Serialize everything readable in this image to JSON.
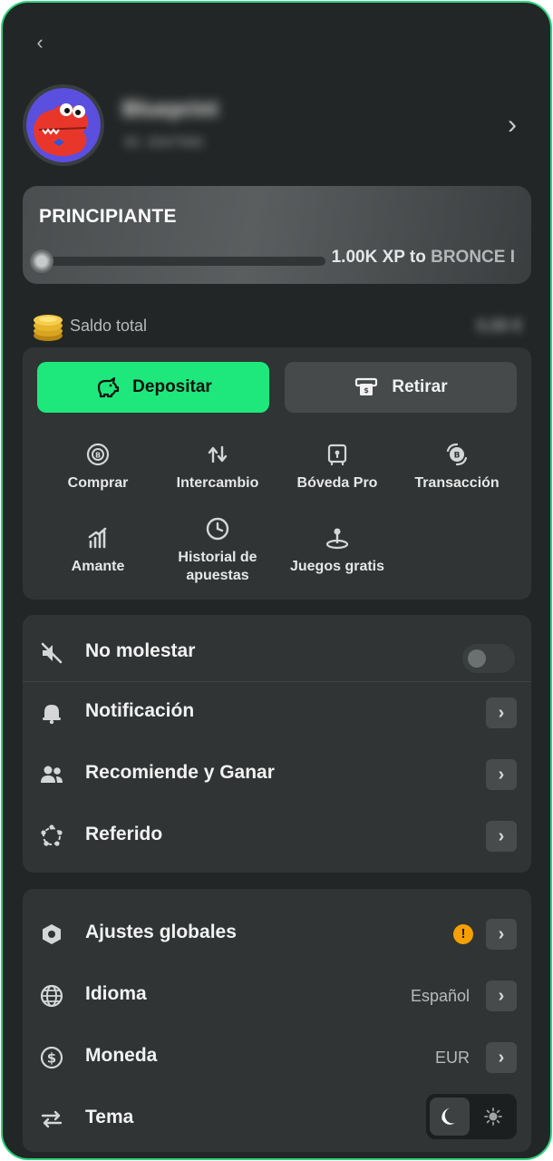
{
  "profile": {
    "username": "Blueprint",
    "user_id": "ID: 3347560"
  },
  "level": {
    "name": "PRINCIPIANTE",
    "xp_amount": "1.00K XP to",
    "xp_target": "BRONCE I",
    "progress": 0.0
  },
  "balance": {
    "label": "Saldo total",
    "value": "0,00 €"
  },
  "wallet": {
    "deposit_label": "Depositar",
    "withdraw_label": "Retirar",
    "actions": [
      {
        "label": "Comprar",
        "icon": "coin-buy-icon"
      },
      {
        "label": "Intercambio",
        "icon": "swap-arrows-icon"
      },
      {
        "label": "Bóveda Pro",
        "icon": "vault-icon"
      },
      {
        "label": "Transacción",
        "icon": "transaction-icon"
      },
      {
        "label": "Amante",
        "icon": "bar-chart-icon"
      },
      {
        "label": "Historial de apuestas",
        "icon": "clock-icon"
      },
      {
        "label": "Juegos gratis",
        "icon": "joystick-icon"
      }
    ]
  },
  "settings_group_1": [
    {
      "label": "No molestar",
      "icon": "mute-icon",
      "toggle": false
    },
    {
      "label": "Notificación",
      "icon": "bell-icon"
    },
    {
      "label": "Recomiende y Ganar",
      "icon": "users-icon"
    },
    {
      "label": "Referido",
      "icon": "network-icon"
    }
  ],
  "settings_group_2": [
    {
      "label": "Ajustes globales",
      "icon": "hexagon-settings-icon",
      "warning": "!"
    },
    {
      "label": "Idioma",
      "icon": "globe-icon",
      "value": "Español"
    },
    {
      "label": "Moneda",
      "icon": "dollar-icon",
      "value": "EUR"
    },
    {
      "label": "Tema",
      "icon": "theme-icon",
      "active_theme": "dark"
    }
  ],
  "colors": {
    "accent_green": "#1ee87c",
    "background": "#232626",
    "card": "#303434",
    "warning": "#f5a000"
  }
}
